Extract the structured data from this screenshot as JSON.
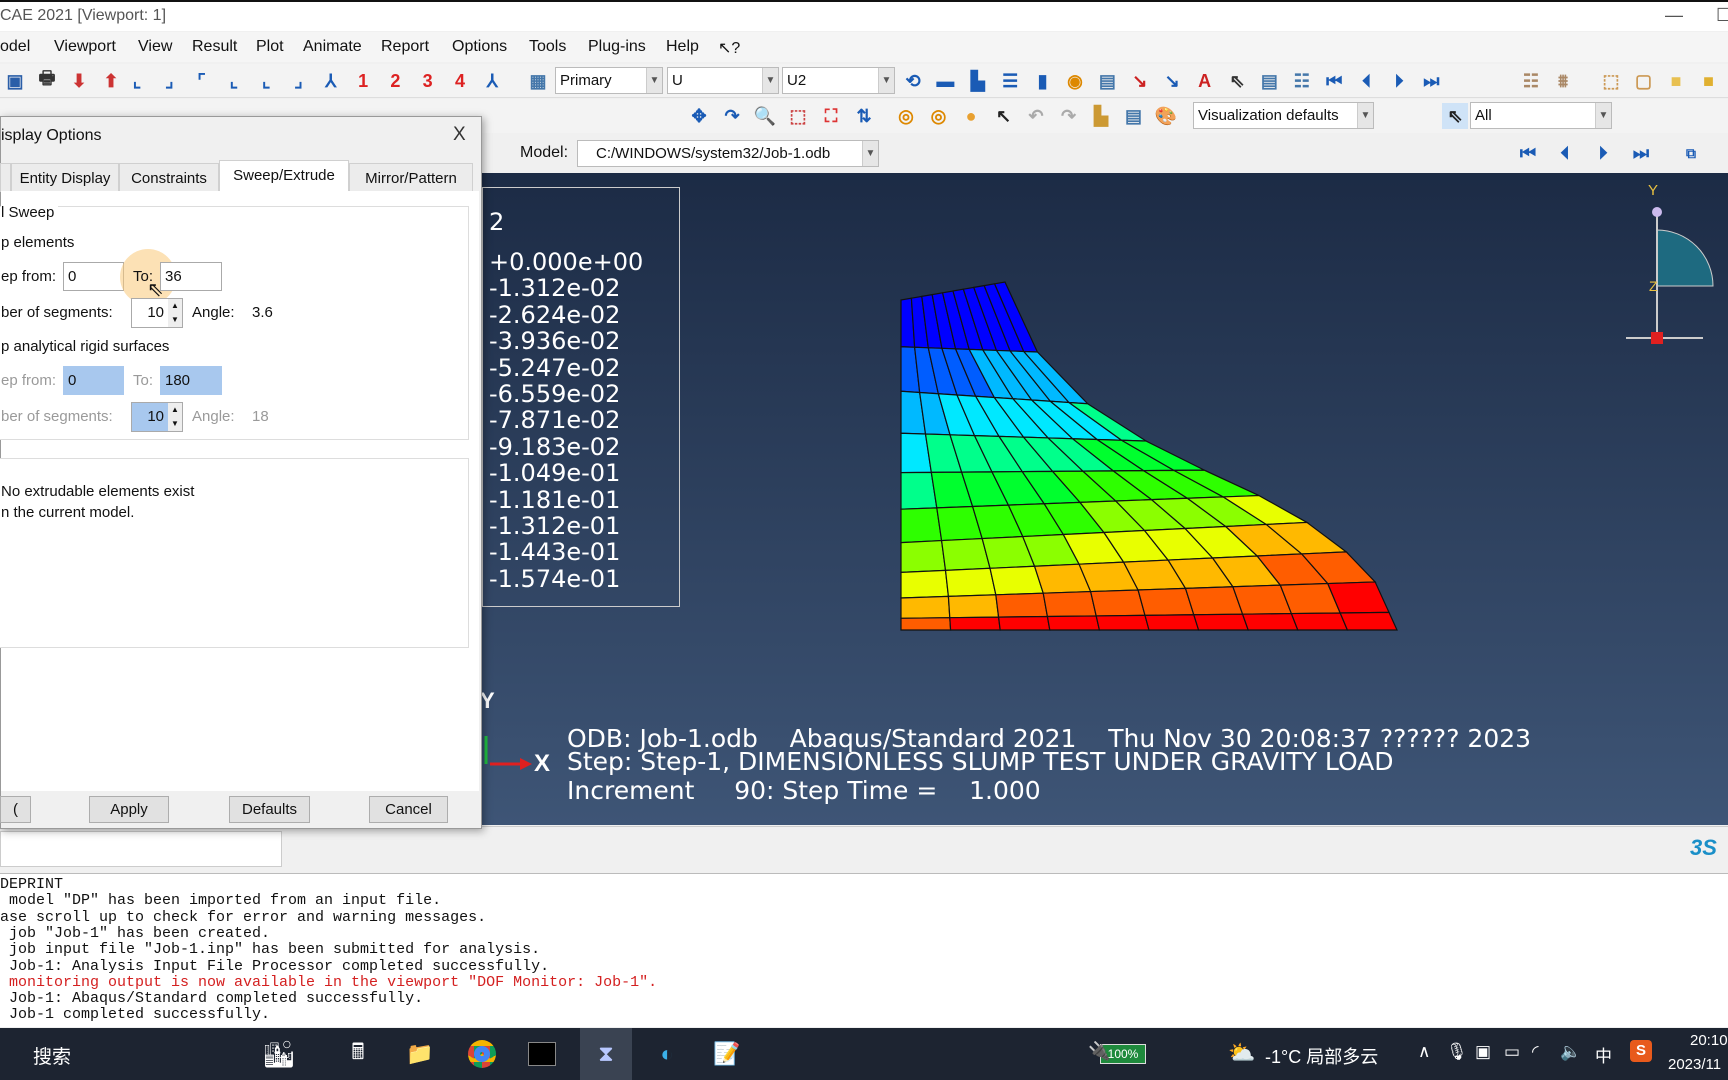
{
  "window": {
    "title": "CAE 2021 [Viewport: 1]",
    "minimize": "—",
    "maximize": "☐"
  },
  "menu": [
    "odel",
    "Viewport",
    "View",
    "Result",
    "Plot",
    "Animate",
    "Report",
    "Options",
    "Tools",
    "Plug-ins",
    "Help",
    "↖?"
  ],
  "toolbar1": {
    "icons": [
      {
        "name": "save-icon",
        "g": "▣",
        "c": "#2a5ea8"
      },
      {
        "name": "print-icon",
        "g": "🖶",
        "c": "#333"
      },
      {
        "name": "import-icon",
        "g": "⬇",
        "c": "#c33"
      },
      {
        "name": "export-icon",
        "g": "⬆",
        "c": "#c33"
      },
      {
        "name": "view-xy-icon",
        "g": "⌞",
        "c": "#1a5bb5"
      },
      {
        "name": "view-yx-icon",
        "g": "⌟",
        "c": "#1a5bb5"
      },
      {
        "name": "view-zx-icon",
        "g": "⌜",
        "c": "#1a5bb5"
      },
      {
        "name": "view-xz-icon",
        "g": "⌞",
        "c": "#1a5bb5"
      },
      {
        "name": "view-yz-icon",
        "g": "⌞",
        "c": "#1a5bb5"
      },
      {
        "name": "view-zy-icon",
        "g": "⌟",
        "c": "#1a5bb5"
      },
      {
        "name": "iso-view-icon",
        "g": "⅄",
        "c": "#1a5bb5"
      },
      {
        "name": "view-1-icon",
        "g": "1",
        "c": "#d22"
      },
      {
        "name": "view-2-icon",
        "g": "2",
        "c": "#d22"
      },
      {
        "name": "view-3-icon",
        "g": "3",
        "c": "#d22"
      },
      {
        "name": "view-4-icon",
        "g": "4",
        "c": "#d22"
      },
      {
        "name": "rotate-view-icon",
        "g": "⅄",
        "c": "#1a5bb5"
      },
      {
        "name": "field-output-icon",
        "g": "▦",
        "c": "#47a"
      }
    ],
    "primary": "Primary",
    "variable": "U",
    "component": "U2",
    "icons2": [
      {
        "name": "sync-icon",
        "g": "⟲",
        "c": "#1a5bb5"
      },
      {
        "name": "viewport-1-icon",
        "g": "▬",
        "c": "#1a5bb5"
      },
      {
        "name": "viewport-cascade-icon",
        "g": "▙",
        "c": "#1a5bb5"
      },
      {
        "name": "tile-horizontal-icon",
        "g": "☰",
        "c": "#1a5bb5"
      },
      {
        "name": "tile-vertical-icon",
        "g": "▮",
        "c": "#1a5bb5"
      },
      {
        "name": "viewport-annot-icon",
        "g": "◉",
        "c": "#d80"
      },
      {
        "name": "table-icon",
        "g": "▤",
        "c": "#47a"
      },
      {
        "name": "text-arrow-icon",
        "g": "↘",
        "c": "#c22"
      },
      {
        "name": "arrow-icon",
        "g": "↘",
        "c": "#1a5bb5"
      },
      {
        "name": "text-icon",
        "g": "A",
        "c": "#c22"
      },
      {
        "name": "select-annot-icon",
        "g": "⇖",
        "c": "#333"
      },
      {
        "name": "annotation-manager-icon",
        "g": "▤",
        "c": "#47a"
      },
      {
        "name": "legend-list-icon",
        "g": "☷",
        "c": "#47a"
      },
      {
        "name": "first-frame-icon",
        "g": "⏮",
        "c": "#1a5bb5"
      },
      {
        "name": "prev-frame-icon",
        "g": "⏴",
        "c": "#1a5bb5"
      },
      {
        "name": "next-frame-icon",
        "g": "⏵",
        "c": "#1a5bb5"
      },
      {
        "name": "last-frame-icon",
        "g": "⏭",
        "c": "#1a5bb5"
      },
      {
        "name": "ladder-icon",
        "g": "☷",
        "c": "#a86"
      },
      {
        "name": "ladder2-icon",
        "g": "⩩",
        "c": "#a86"
      },
      {
        "name": "wireframe-icon",
        "g": "⬚",
        "c": "#c95"
      },
      {
        "name": "hidden-icon",
        "g": "▢",
        "c": "#c95"
      },
      {
        "name": "filled-icon",
        "g": "■",
        "c": "#e8c050"
      },
      {
        "name": "shaded-icon",
        "g": "■",
        "c": "#e0b030"
      }
    ]
  },
  "toolbar2": {
    "icons": [
      {
        "name": "pan-icon",
        "g": "✥",
        "c": "#1a5bb5"
      },
      {
        "name": "rotate-icon",
        "g": "↷",
        "c": "#1a5bb5"
      },
      {
        "name": "zoom-icon",
        "g": "🔍",
        "c": "#999"
      },
      {
        "name": "box-zoom-icon",
        "g": "⬚",
        "c": "#c44"
      },
      {
        "name": "auto-fit-icon",
        "g": "⛶",
        "c": "#d33"
      },
      {
        "name": "cycle-views-icon",
        "g": "⇅",
        "c": "#1a5bb5"
      }
    ],
    "icons2": [
      {
        "name": "boolean-union-icon",
        "g": "◎",
        "c": "#d80"
      },
      {
        "name": "boolean-intersect-icon",
        "g": "◎",
        "c": "#d80"
      },
      {
        "name": "boolean-sphere-icon",
        "g": "●",
        "c": "#e8a030"
      },
      {
        "name": "tool-icon",
        "g": "↖",
        "c": "#222"
      },
      {
        "name": "undo-icon",
        "g": "↶",
        "c": "#aaa"
      },
      {
        "name": "redo-icon",
        "g": "↷",
        "c": "#aaa"
      },
      {
        "name": "bars-icon",
        "g": "▙",
        "c": "#c93"
      },
      {
        "name": "options-table-icon",
        "g": "▤",
        "c": "#47a"
      },
      {
        "name": "palette-icon",
        "g": "🎨",
        "c": "#c93"
      }
    ],
    "visualization": "Visualization defaults",
    "select_filter": "All"
  },
  "toolbar3": {
    "model_label": "Model:",
    "model_value": "C:/WINDOWS/system32/Job-1.odb"
  },
  "legend": {
    "header": "2",
    "values": [
      "+0.000e+00",
      "-1.312e-02",
      "-2.624e-02",
      "-3.936e-02",
      "-5.247e-02",
      "-6.559e-02",
      "-7.871e-02",
      "-9.183e-02",
      "-1.049e-01",
      "-1.181e-01",
      "-1.312e-01",
      "-1.443e-01",
      "-1.574e-01"
    ]
  },
  "contour_colors": [
    "#ff0000",
    "#ff5d00",
    "#ffb900",
    "#e8ff00",
    "#8bff00",
    "#2eff00",
    "#00ff2e",
    "#00ff8b",
    "#00e8ff",
    "#00b9ff",
    "#005dff",
    "#0000ff"
  ],
  "viewport_info": {
    "line1": "ODB: Job-1.odb    Abaqus/Standard 2021    Thu Nov 30 20:08:37 ?????? 2023",
    "line2": "Step: Step-1, DIMENSIONLESS SLUMP TEST UNDER GRAVITY LOAD",
    "line3": "Increment     90: Step Time =    1.000"
  },
  "triad": {
    "y": "Y",
    "x": "X",
    "z": "Z"
  },
  "dialog": {
    "title": "isplay Options",
    "close": "X",
    "tabs": [
      "Entity Display",
      "Constraints",
      "Sweep/Extrude",
      "Mirror/Pattern"
    ],
    "sweep_group": "l Sweep",
    "sweep_elements": "p elements",
    "from_label": "ep from:",
    "from_value": "0",
    "to_label": "To:",
    "to_value": "36",
    "segments_label": "ber of segments:",
    "segments_value": "10",
    "angle_label": "Angle:",
    "angle_value": "3.6",
    "rigid_label": "p analytical rigid surfaces",
    "rigid_from": "0",
    "rigid_to": "180",
    "rigid_segments": "10",
    "rigid_angle": "18",
    "extrude_msg1": "No extrudable elements exist",
    "extrude_msg2": "n the current model.",
    "buttons": {
      "ok": "(",
      "apply": "Apply",
      "defaults": "Defaults",
      "cancel": "Cancel"
    }
  },
  "console": [
    {
      "t": "DEPRINT"
    },
    {
      "t": " model \"DP\" has been imported from an input file."
    },
    {
      "t": "ase scroll up to check for error and warning messages."
    },
    {
      "t": " job \"Job-1\" has been created."
    },
    {
      "t": " job input file \"Job-1.inp\" has been submitted for analysis."
    },
    {
      "t": " Job-1: Analysis Input File Processor completed successfully."
    },
    {
      "t": " monitoring output is now available in the viewport \"DOF Monitor: Job-1\".",
      "red": true
    },
    {
      "t": " Job-1: Abaqus/Standard completed successfully."
    },
    {
      "t": " Job-1 completed successfully."
    }
  ],
  "taskbar": {
    "search": "搜索",
    "battery": "100%",
    "weather": "-1°C 局部多云",
    "ime": "中",
    "time": "20:10",
    "date": "2023/11"
  }
}
